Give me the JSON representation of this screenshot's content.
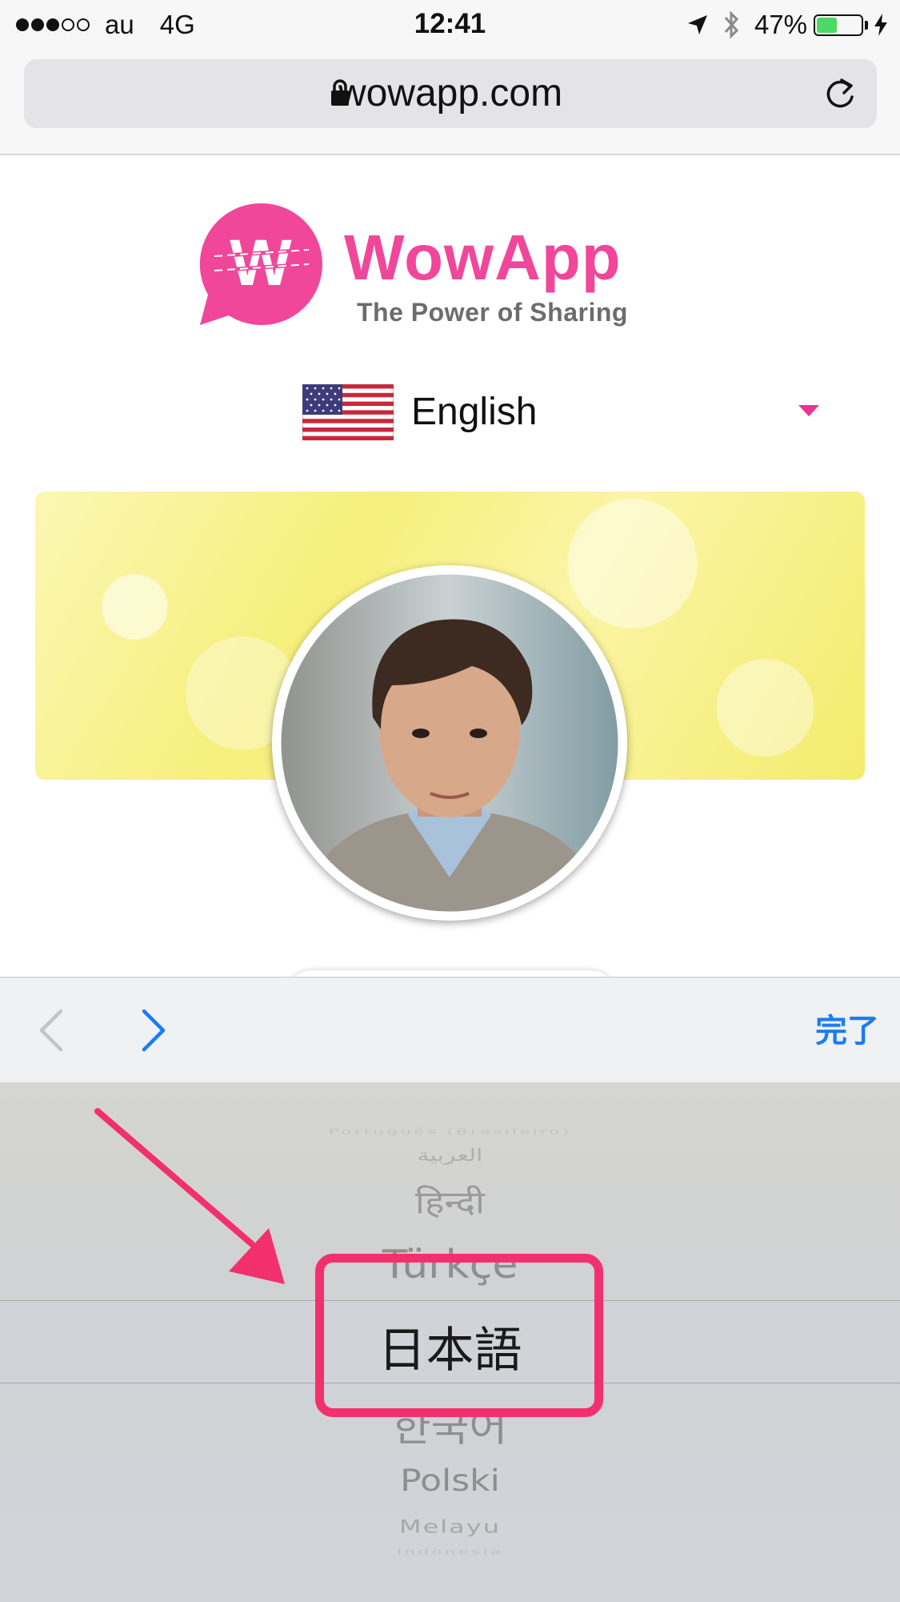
{
  "status_bar": {
    "signal_bars": 3,
    "signal_total": 5,
    "carrier": "au",
    "network": "4G",
    "time": "12:41",
    "battery_percent_label": "47%",
    "battery_level": 0.47,
    "icons": [
      "location-arrow-icon",
      "bluetooth-icon",
      "battery-icon",
      "charging-bolt-icon"
    ]
  },
  "browser": {
    "url": "wowapp.com"
  },
  "brand": {
    "name": "WowApp",
    "tagline": "The Power of Sharing",
    "logo_letter": "W",
    "color": "#f0479a"
  },
  "language_selector": {
    "selected": "English",
    "flag": "us-flag-icon",
    "caret_color": "#e8358f"
  },
  "picker_toolbar": {
    "done_label": "完了",
    "prev_enabled": false,
    "next_enabled": true,
    "accent": "#1a7cf5"
  },
  "picker": {
    "options": [
      "Português (Brasileiro)",
      "العربية",
      "हिन्दी",
      "Türkçe",
      "日本語",
      "한국어",
      "Polski",
      "Melayu",
      "Indonesia"
    ],
    "selected_index": 4
  },
  "annotation": {
    "highlight_color": "#f2306e"
  }
}
